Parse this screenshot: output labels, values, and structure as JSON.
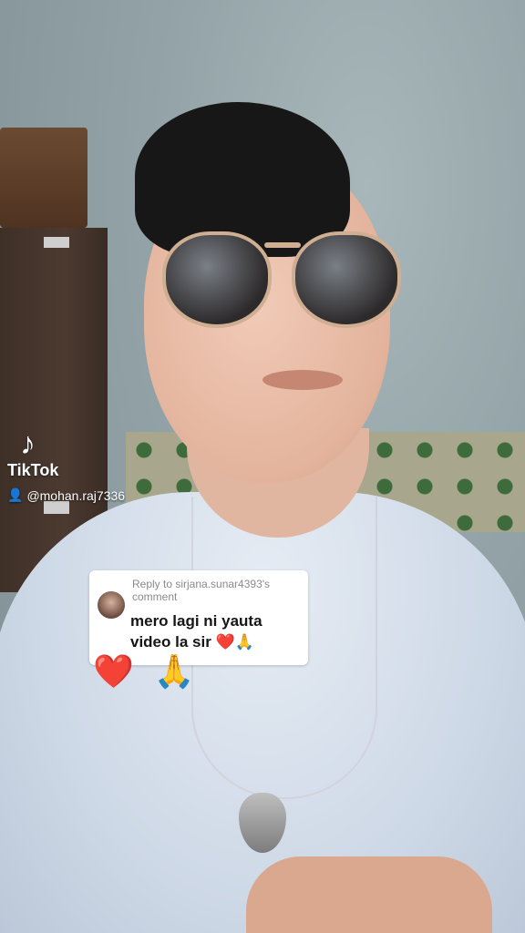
{
  "watermark": {
    "logo_icon": "tiktok-note-icon",
    "brand": "TikTok",
    "user_icon": "person-icon",
    "username": "@mohan.raj7336"
  },
  "reply": {
    "meta": "Reply to sirjana.sunar4393's comment",
    "text": "mero lagi ni yauta video la sir ❤️🙏"
  },
  "overlay_emojis": "❤️ 🙏"
}
